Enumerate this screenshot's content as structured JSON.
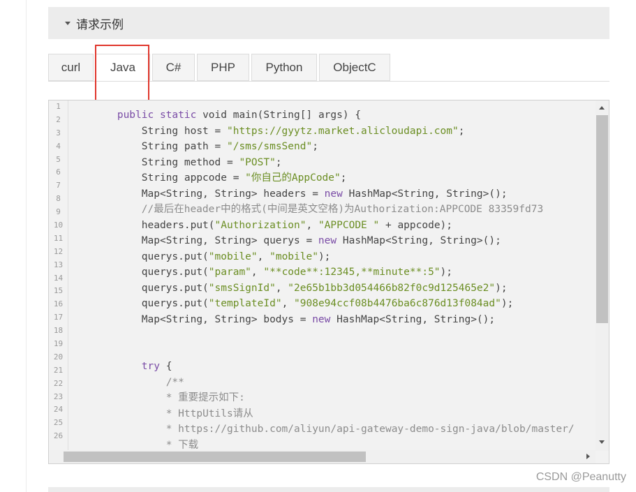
{
  "section": {
    "title": "请求示例"
  },
  "tabs": [
    {
      "label": "curl",
      "active": false
    },
    {
      "label": "Java",
      "active": true
    },
    {
      "label": "C#",
      "active": false
    },
    {
      "label": "PHP",
      "active": false
    },
    {
      "label": "Python",
      "active": false
    },
    {
      "label": "ObjectC",
      "active": false
    }
  ],
  "highlight_color": "#e0352b",
  "code": {
    "line_numbers": [
      "1",
      "2",
      "3",
      "4",
      "5",
      "6",
      "7",
      "8",
      "9",
      "10",
      "11",
      "12",
      "13",
      "14",
      "15",
      "16",
      "17",
      "18",
      "19",
      "20",
      "21",
      "22",
      "23",
      "24",
      "25",
      "26"
    ],
    "lines": [
      [
        {
          "t": "        "
        },
        {
          "t": "public static",
          "c": "kw"
        },
        {
          "t": " void main(String[] args) {"
        }
      ],
      [
        {
          "t": "            String host = "
        },
        {
          "t": "\"https://gyytz.market.alicloudapi.com\"",
          "c": "str"
        },
        {
          "t": ";"
        }
      ],
      [
        {
          "t": "            String path = "
        },
        {
          "t": "\"/sms/smsSend\"",
          "c": "str"
        },
        {
          "t": ";"
        }
      ],
      [
        {
          "t": "            String method = "
        },
        {
          "t": "\"POST\"",
          "c": "str"
        },
        {
          "t": ";"
        }
      ],
      [
        {
          "t": "            String appcode = "
        },
        {
          "t": "\"你自己的AppCode\"",
          "c": "str"
        },
        {
          "t": ";"
        }
      ],
      [
        {
          "t": "            Map<String, String> headers = "
        },
        {
          "t": "new",
          "c": "kw"
        },
        {
          "t": " HashMap<String, String>();"
        }
      ],
      [
        {
          "t": "            "
        },
        {
          "t": "//最后在header中的格式(中间是英文空格)为Authorization:APPCODE 83359fd73",
          "c": "com"
        }
      ],
      [
        {
          "t": "            headers.put("
        },
        {
          "t": "\"Authorization\"",
          "c": "str"
        },
        {
          "t": ", "
        },
        {
          "t": "\"APPCODE \"",
          "c": "str"
        },
        {
          "t": " + appcode);"
        }
      ],
      [
        {
          "t": "            Map<String, String> querys = "
        },
        {
          "t": "new",
          "c": "kw"
        },
        {
          "t": " HashMap<String, String>();"
        }
      ],
      [
        {
          "t": "            querys.put("
        },
        {
          "t": "\"mobile\"",
          "c": "str"
        },
        {
          "t": ", "
        },
        {
          "t": "\"mobile\"",
          "c": "str"
        },
        {
          "t": ");"
        }
      ],
      [
        {
          "t": "            querys.put("
        },
        {
          "t": "\"param\"",
          "c": "str"
        },
        {
          "t": ", "
        },
        {
          "t": "\"**code**:12345,**minute**:5\"",
          "c": "str"
        },
        {
          "t": ");"
        }
      ],
      [
        {
          "t": "            querys.put("
        },
        {
          "t": "\"smsSignId\"",
          "c": "str"
        },
        {
          "t": ", "
        },
        {
          "t": "\"2e65b1bb3d054466b82f0c9d125465e2\"",
          "c": "str"
        },
        {
          "t": ");"
        }
      ],
      [
        {
          "t": "            querys.put("
        },
        {
          "t": "\"templateId\"",
          "c": "str"
        },
        {
          "t": ", "
        },
        {
          "t": "\"908e94ccf08b4476ba6c876d13f084ad\"",
          "c": "str"
        },
        {
          "t": ");"
        }
      ],
      [
        {
          "t": "            Map<String, String> bodys = "
        },
        {
          "t": "new",
          "c": "kw"
        },
        {
          "t": " HashMap<String, String>();"
        }
      ],
      [
        {
          "t": ""
        }
      ],
      [
        {
          "t": ""
        }
      ],
      [
        {
          "t": "            "
        },
        {
          "t": "try",
          "c": "kw"
        },
        {
          "t": " {"
        }
      ],
      [
        {
          "t": "                "
        },
        {
          "t": "/**",
          "c": "com"
        }
      ],
      [
        {
          "t": "                "
        },
        {
          "t": "* 重要提示如下:",
          "c": "com"
        }
      ],
      [
        {
          "t": "                "
        },
        {
          "t": "* HttpUtils请从",
          "c": "com"
        }
      ],
      [
        {
          "t": "                "
        },
        {
          "t": "* https://github.com/aliyun/api-gateway-demo-sign-java/blob/master/",
          "c": "com"
        }
      ],
      [
        {
          "t": "                "
        },
        {
          "t": "* 下载",
          "c": "com"
        }
      ]
    ]
  },
  "watermark": "CSDN @Peanutty"
}
